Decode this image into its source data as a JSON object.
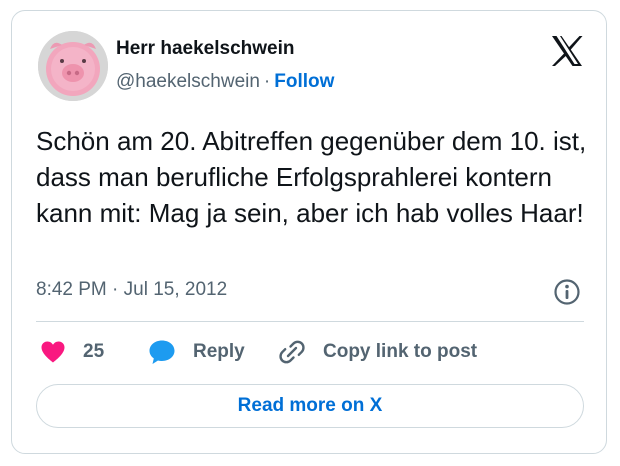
{
  "author": {
    "display_name": "Herr haekelschwein",
    "handle": "@haekelschwein",
    "separator": "·",
    "follow_label": "Follow"
  },
  "tweet": {
    "text": "Schön am 20. Abitreffen gegenüber dem 10. ist, dass man berufliche Erfolgsprahlerei kontern kann mit: Mag ja sein, aber ich hab volles Haar!",
    "timestamp": "8:42 PM · Jul 15, 2012"
  },
  "actions": {
    "like_count": "25",
    "reply_label": "Reply",
    "copy_link_label": "Copy link to post"
  },
  "footer": {
    "read_more_label": "Read more on X"
  },
  "icons": {
    "brand": "x-logo-icon",
    "info": "info-icon",
    "like": "heart-icon",
    "reply": "speech-bubble-icon",
    "copy": "link-icon"
  },
  "colors": {
    "text_primary": "#0f1419",
    "text_secondary": "#536471",
    "link_blue": "#006fd6",
    "like_pink": "#f91880",
    "reply_blue": "#1d9bf0",
    "border": "#cfd9de"
  }
}
